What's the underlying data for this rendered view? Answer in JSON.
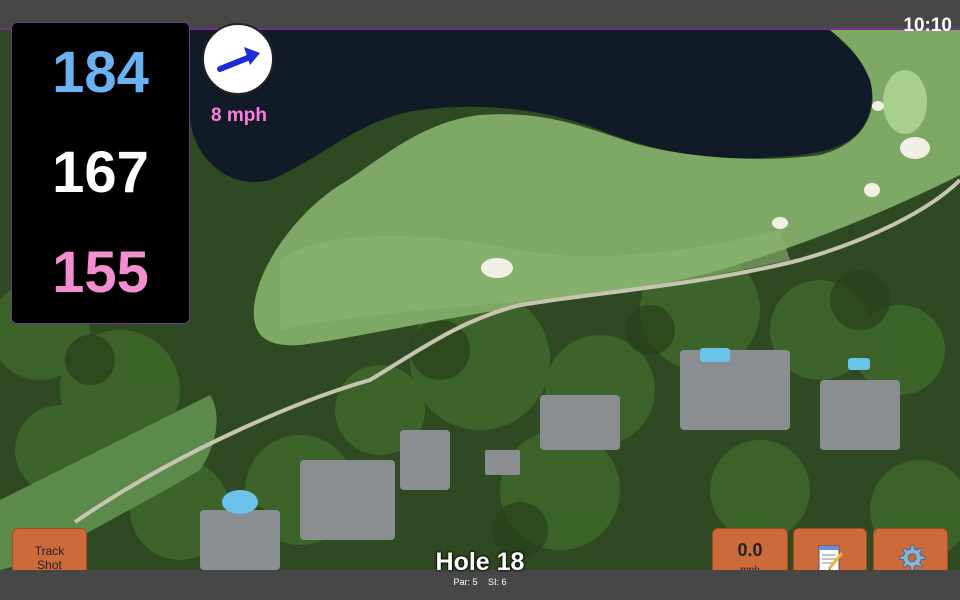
{
  "status": {
    "time": "10:10"
  },
  "distances": [
    {
      "value": "184",
      "color": "#6ab2f4"
    },
    {
      "value": "167",
      "color": "#ffffff"
    },
    {
      "value": "155",
      "color": "#f48cd2"
    }
  ],
  "wind": {
    "speed_label": "8 mph",
    "arrow_icon": "wind-direction-arrow-icon",
    "arrow_color": "#1a2bdb"
  },
  "buttons": {
    "track_shot": "Track\nShot",
    "wind_value": "0.0",
    "wind_unit": "mph",
    "notes_icon": "notepad-icon",
    "settings_icon": "gear-icon"
  },
  "hole": {
    "title": "Hole 18",
    "par": "Par: 5",
    "si": "SI: 6"
  }
}
